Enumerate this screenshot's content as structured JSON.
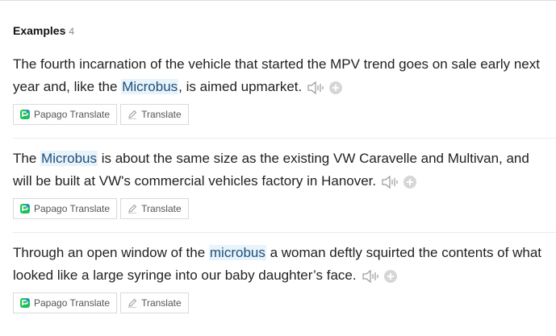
{
  "section": {
    "title": "Examples",
    "count": "4"
  },
  "buttons": {
    "papago": "Papago Translate",
    "translate": "Translate"
  },
  "icons": {
    "papago": "papago-logo-icon",
    "translate": "pencil-icon",
    "audio": "speaker-icon",
    "add": "plus-circle-icon"
  },
  "colors": {
    "highlight_bg": "#e8f3fb",
    "papago_green": "#1fbf5a",
    "papago_blue": "#2a86e8"
  },
  "examples": [
    {
      "before": "The fourth incarnation of the vehicle that started the MPV trend goes on sale early next year and, like the ",
      "keyword": "Microbus",
      "after": ", is aimed upmarket."
    },
    {
      "before": "The ",
      "keyword": "Microbus",
      "after": " is about the same size as the existing VW Caravelle and Multivan, and will be built at VW's commercial vehicles factory in Hanover."
    },
    {
      "before": "Through an open window of the ",
      "keyword": "microbus",
      "after": " a woman deftly squirted the contents of what looked like a large syringe into our baby daughter’s face."
    }
  ]
}
